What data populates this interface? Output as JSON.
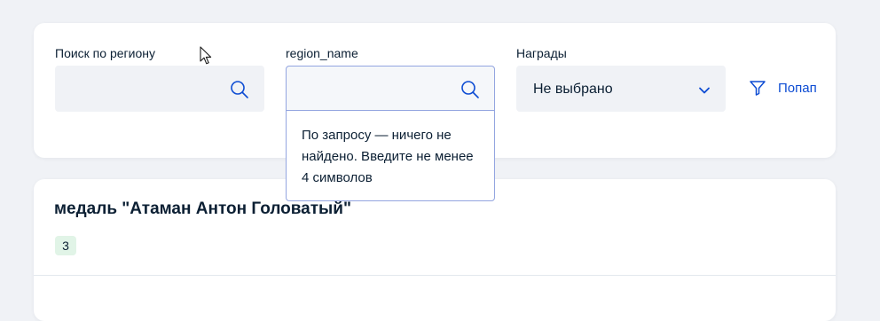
{
  "filters": {
    "region_search": {
      "label": "Поиск по региону",
      "value": "",
      "placeholder": ""
    },
    "region_name": {
      "label": "region_name",
      "value": "",
      "placeholder": ""
    },
    "awards": {
      "label": "Награды",
      "selected": "Не выбрано"
    },
    "popup_button_label": "Попап"
  },
  "popover": {
    "message": "По запросу — ничего не найдено. Введите не менее 4 символов"
  },
  "result": {
    "title": "медаль \"Атаман Антон Головатый\"",
    "count": "3"
  },
  "colors": {
    "accent": "#0d4cd3",
    "icon": "#0d4cd3",
    "badge_bg": "#e1f4e7",
    "page_bg": "#f0f2f6",
    "focus_border": "#93a5e0",
    "text": "#0b1f33"
  }
}
